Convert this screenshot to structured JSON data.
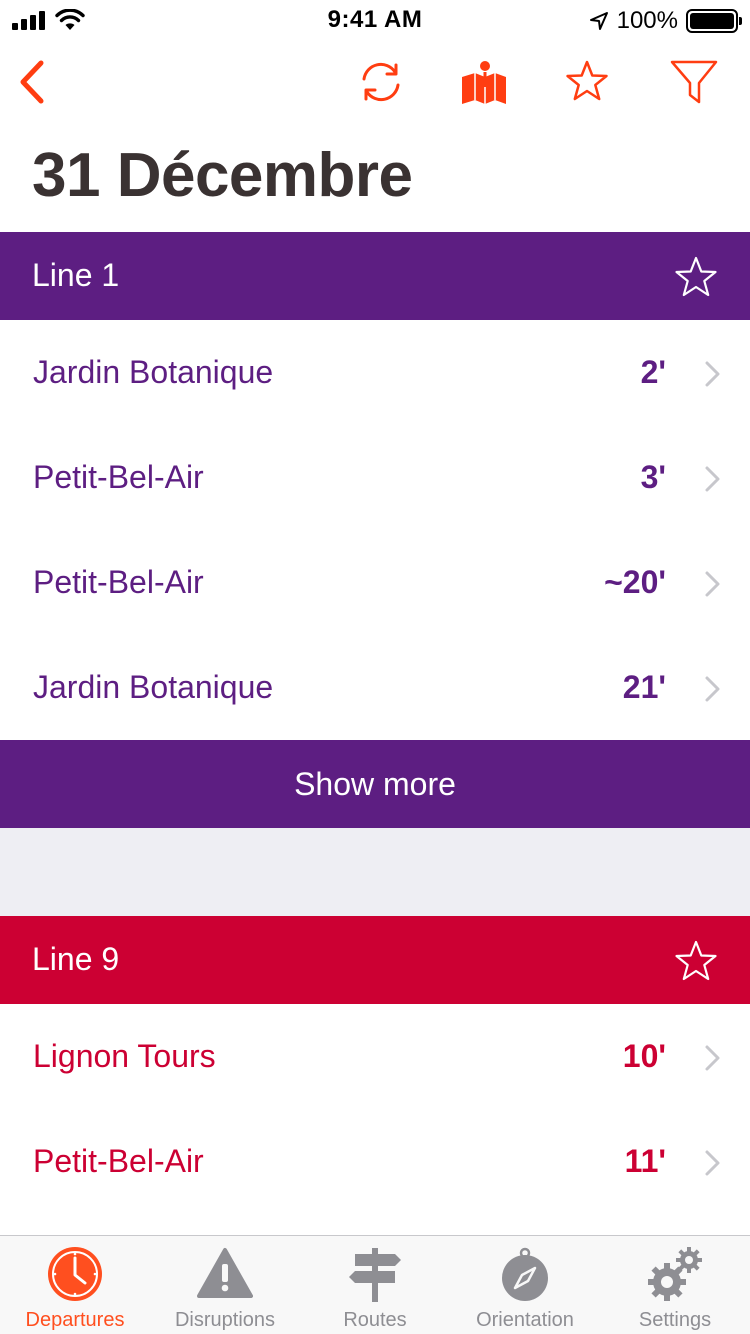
{
  "status_bar": {
    "time": "9:41 AM",
    "battery": "100%"
  },
  "nav": {
    "icons": [
      "back-chevron-icon",
      "refresh-icon",
      "map-icon",
      "favorite-star-icon",
      "filter-icon"
    ],
    "accent_color": "#ff3d11"
  },
  "page": {
    "title": "31 Décembre"
  },
  "lines": [
    {
      "name": "Line 1",
      "color": "#5d1e82",
      "departures": [
        {
          "destination": "Jardin Botanique",
          "minutes": "2'"
        },
        {
          "destination": "Petit-Bel-Air",
          "minutes": "3'"
        },
        {
          "destination": "Petit-Bel-Air",
          "minutes": "~20'"
        },
        {
          "destination": "Jardin Botanique",
          "minutes": "21'"
        }
      ],
      "show_more_label": "Show more"
    },
    {
      "name": "Line 9",
      "color": "#cc0033",
      "departures": [
        {
          "destination": "Lignon Tours",
          "minutes": "10'"
        },
        {
          "destination": "Petit-Bel-Air",
          "minutes": "11'"
        }
      ]
    }
  ],
  "tabs": [
    {
      "label": "Departures",
      "icon": "clock-icon",
      "active": true
    },
    {
      "label": "Disruptions",
      "icon": "warning-icon",
      "active": false
    },
    {
      "label": "Routes",
      "icon": "signpost-icon",
      "active": false
    },
    {
      "label": "Orientation",
      "icon": "compass-icon",
      "active": false
    },
    {
      "label": "Settings",
      "icon": "gears-icon",
      "active": false
    }
  ]
}
